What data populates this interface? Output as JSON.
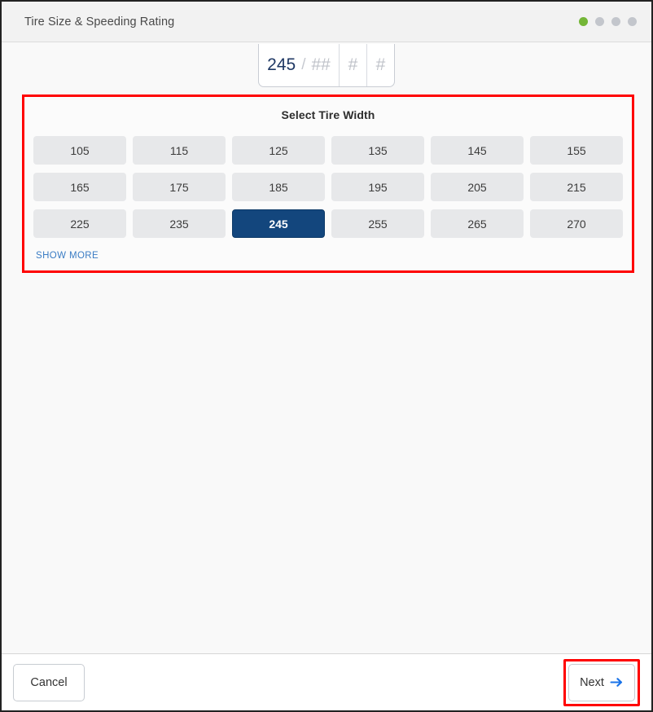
{
  "window": {
    "title": "Tire Size & Speeding Rating"
  },
  "progress": {
    "dots": [
      {
        "state": "active"
      },
      {
        "state": "inactive"
      },
      {
        "state": "inactive"
      },
      {
        "state": "inactive"
      }
    ],
    "active_color": "#74b637",
    "inactive_color": "#c3c6cc"
  },
  "size_display": {
    "width_value": "245",
    "separator": "/",
    "aspect_placeholder": "##",
    "diameter_placeholder": "#",
    "speed_placeholder": "#",
    "value_color": "#1f3864",
    "placeholder_color": "#bfc2c9"
  },
  "panel": {
    "title": "Select Tire Width",
    "highlight_color": "#ff0000",
    "selected_value": "245",
    "selected_color": "#13467d",
    "options": [
      "105",
      "115",
      "125",
      "135",
      "145",
      "155",
      "165",
      "175",
      "185",
      "195",
      "205",
      "215",
      "225",
      "235",
      "245",
      "255",
      "265",
      "270"
    ],
    "show_more_label": "SHOW MORE",
    "show_more_color": "#3a7cc4"
  },
  "footer": {
    "cancel_label": "Cancel",
    "next_label": "Next",
    "next_icon": "arrow-right-icon",
    "next_icon_color": "#1a73e8",
    "next_highlight_color": "#ff0000"
  }
}
